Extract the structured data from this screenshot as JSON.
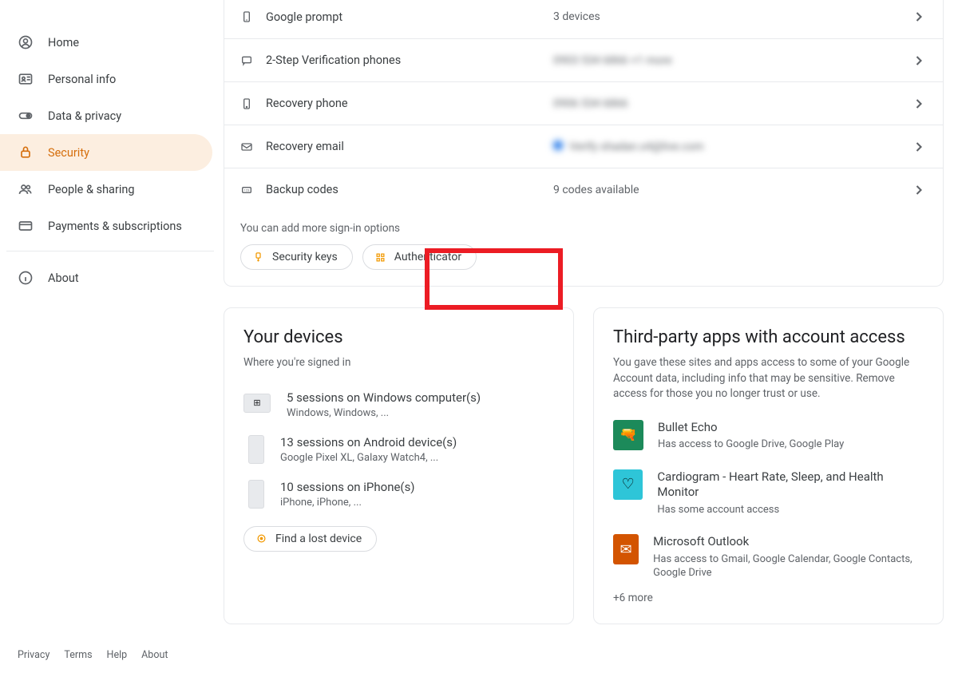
{
  "sidebar": {
    "items": [
      {
        "label": "Home"
      },
      {
        "label": "Personal info"
      },
      {
        "label": "Data & privacy"
      },
      {
        "label": "Security"
      },
      {
        "label": "People & sharing"
      },
      {
        "label": "Payments & subscriptions"
      },
      {
        "label": "About"
      }
    ],
    "footer": [
      "Privacy",
      "Terms",
      "Help",
      "About"
    ]
  },
  "signin": {
    "rows": [
      {
        "label": "Google prompt",
        "value": "3 devices"
      },
      {
        "label": "2-Step Verification phones",
        "value": "0903 534 6866 +1 more",
        "blurred": true
      },
      {
        "label": "Recovery phone",
        "value": "0906 534 6866",
        "blurred": true
      },
      {
        "label": "Recovery email",
        "value": "Verify shadan.s4@live.com",
        "blurred": true,
        "bluedot": true
      },
      {
        "label": "Backup codes",
        "value": "9 codes available"
      }
    ],
    "hint": "You can add more sign-in options",
    "chips": {
      "security_keys": "Security keys",
      "authenticator": "Authenticator"
    }
  },
  "devices": {
    "title": "Your devices",
    "subtitle": "Where you're signed in",
    "items": [
      {
        "title": "5 sessions on Windows computer(s)",
        "sub": "Windows, Windows, ..."
      },
      {
        "title": "13 sessions on Android device(s)",
        "sub": "Google Pixel XL, Galaxy Watch4, ..."
      },
      {
        "title": "10 sessions on iPhone(s)",
        "sub": "iPhone, iPhone, ..."
      }
    ],
    "find": "Find a lost device"
  },
  "thirdparty": {
    "title": "Third-party apps with account access",
    "subtitle": "You gave these sites and apps access to some of your Google Account data, including info that may be sensitive. Remove access for those you no longer trust or use.",
    "items": [
      {
        "title": "Bullet Echo",
        "sub": "Has access to Google Drive, Google Play"
      },
      {
        "title": "Cardiogram - Heart Rate, Sleep, and Health Monitor",
        "sub": "Has some account access"
      },
      {
        "title": "Microsoft Outlook",
        "sub": "Has access to Gmail, Google Calendar, Google Contacts, Google Drive"
      }
    ],
    "more": "+6 more"
  }
}
